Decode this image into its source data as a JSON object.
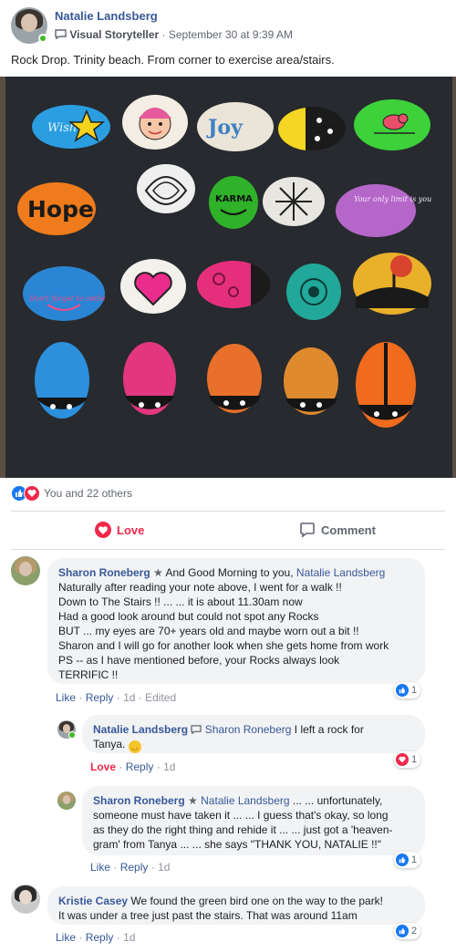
{
  "post": {
    "author": "Natalie Landsberg",
    "badge": "Visual Storyteller",
    "time": "September 30 at 9:39 AM",
    "text": "Rock Drop. Trinity beach. From corner to exercise area/stairs."
  },
  "photo": {
    "rock_texts": [
      "Wish",
      "Joy",
      "Hope",
      "KARMA",
      "Your only limit is you",
      "Don't forget to smile"
    ]
  },
  "reactions": {
    "summary": "You and 22 others"
  },
  "actions": {
    "love": "Love",
    "comment": "Comment"
  },
  "comments": [
    {
      "author": "Sharon Roneberg",
      "mention": "Natalie Landsberg",
      "intro": "And Good Morning to you,",
      "lines": [
        "Naturally after reading your note above, I went for a walk !!",
        "Down to The Stairs !! ... ... it is about 11.30am now",
        "Had a good look around but could not spot any Rocks",
        "BUT ... my eyes are 70+ years old and maybe worn out a bit !!",
        "Sharon and I will go for another look when she gets home from work",
        "PS -- as I have mentioned before, your Rocks always look",
        "TERRIFIC !!"
      ],
      "like": "Like",
      "reply": "Reply",
      "time": "1d",
      "edited": "Edited",
      "count": "1"
    },
    {
      "author": "Natalie Landsberg",
      "mention": "Sharon Roneberg",
      "text1": "I left a rock for",
      "text2": "Tanya.",
      "love": "Love",
      "reply": "Reply",
      "time": "1d",
      "count": "1"
    },
    {
      "author": "Sharon Roneberg",
      "mention": "Natalie Landsberg",
      "lines": [
        "... ... unfortunately,",
        "someone must have taken it ... ... I guess that's okay, so long",
        "as they do the right thing and rehide it ... ... just got a 'heaven-",
        "gram' from Tanya ... ... she says \"THANK YOU, NATALIE !!\""
      ],
      "like": "Like",
      "reply": "Reply",
      "time": "1d",
      "count": "1"
    },
    {
      "author": "Kristie Casey",
      "text1": "We found the green bird one on the way to the park!",
      "text2": "It was under a tree just past the stairs. That was around 11am",
      "like": "Like",
      "reply": "Reply",
      "time": "1d",
      "count": "2"
    }
  ],
  "colors": {
    "link": "#385898",
    "love": "#f0284a",
    "like": "#1877f2",
    "bubble": "#f2f3f5"
  }
}
